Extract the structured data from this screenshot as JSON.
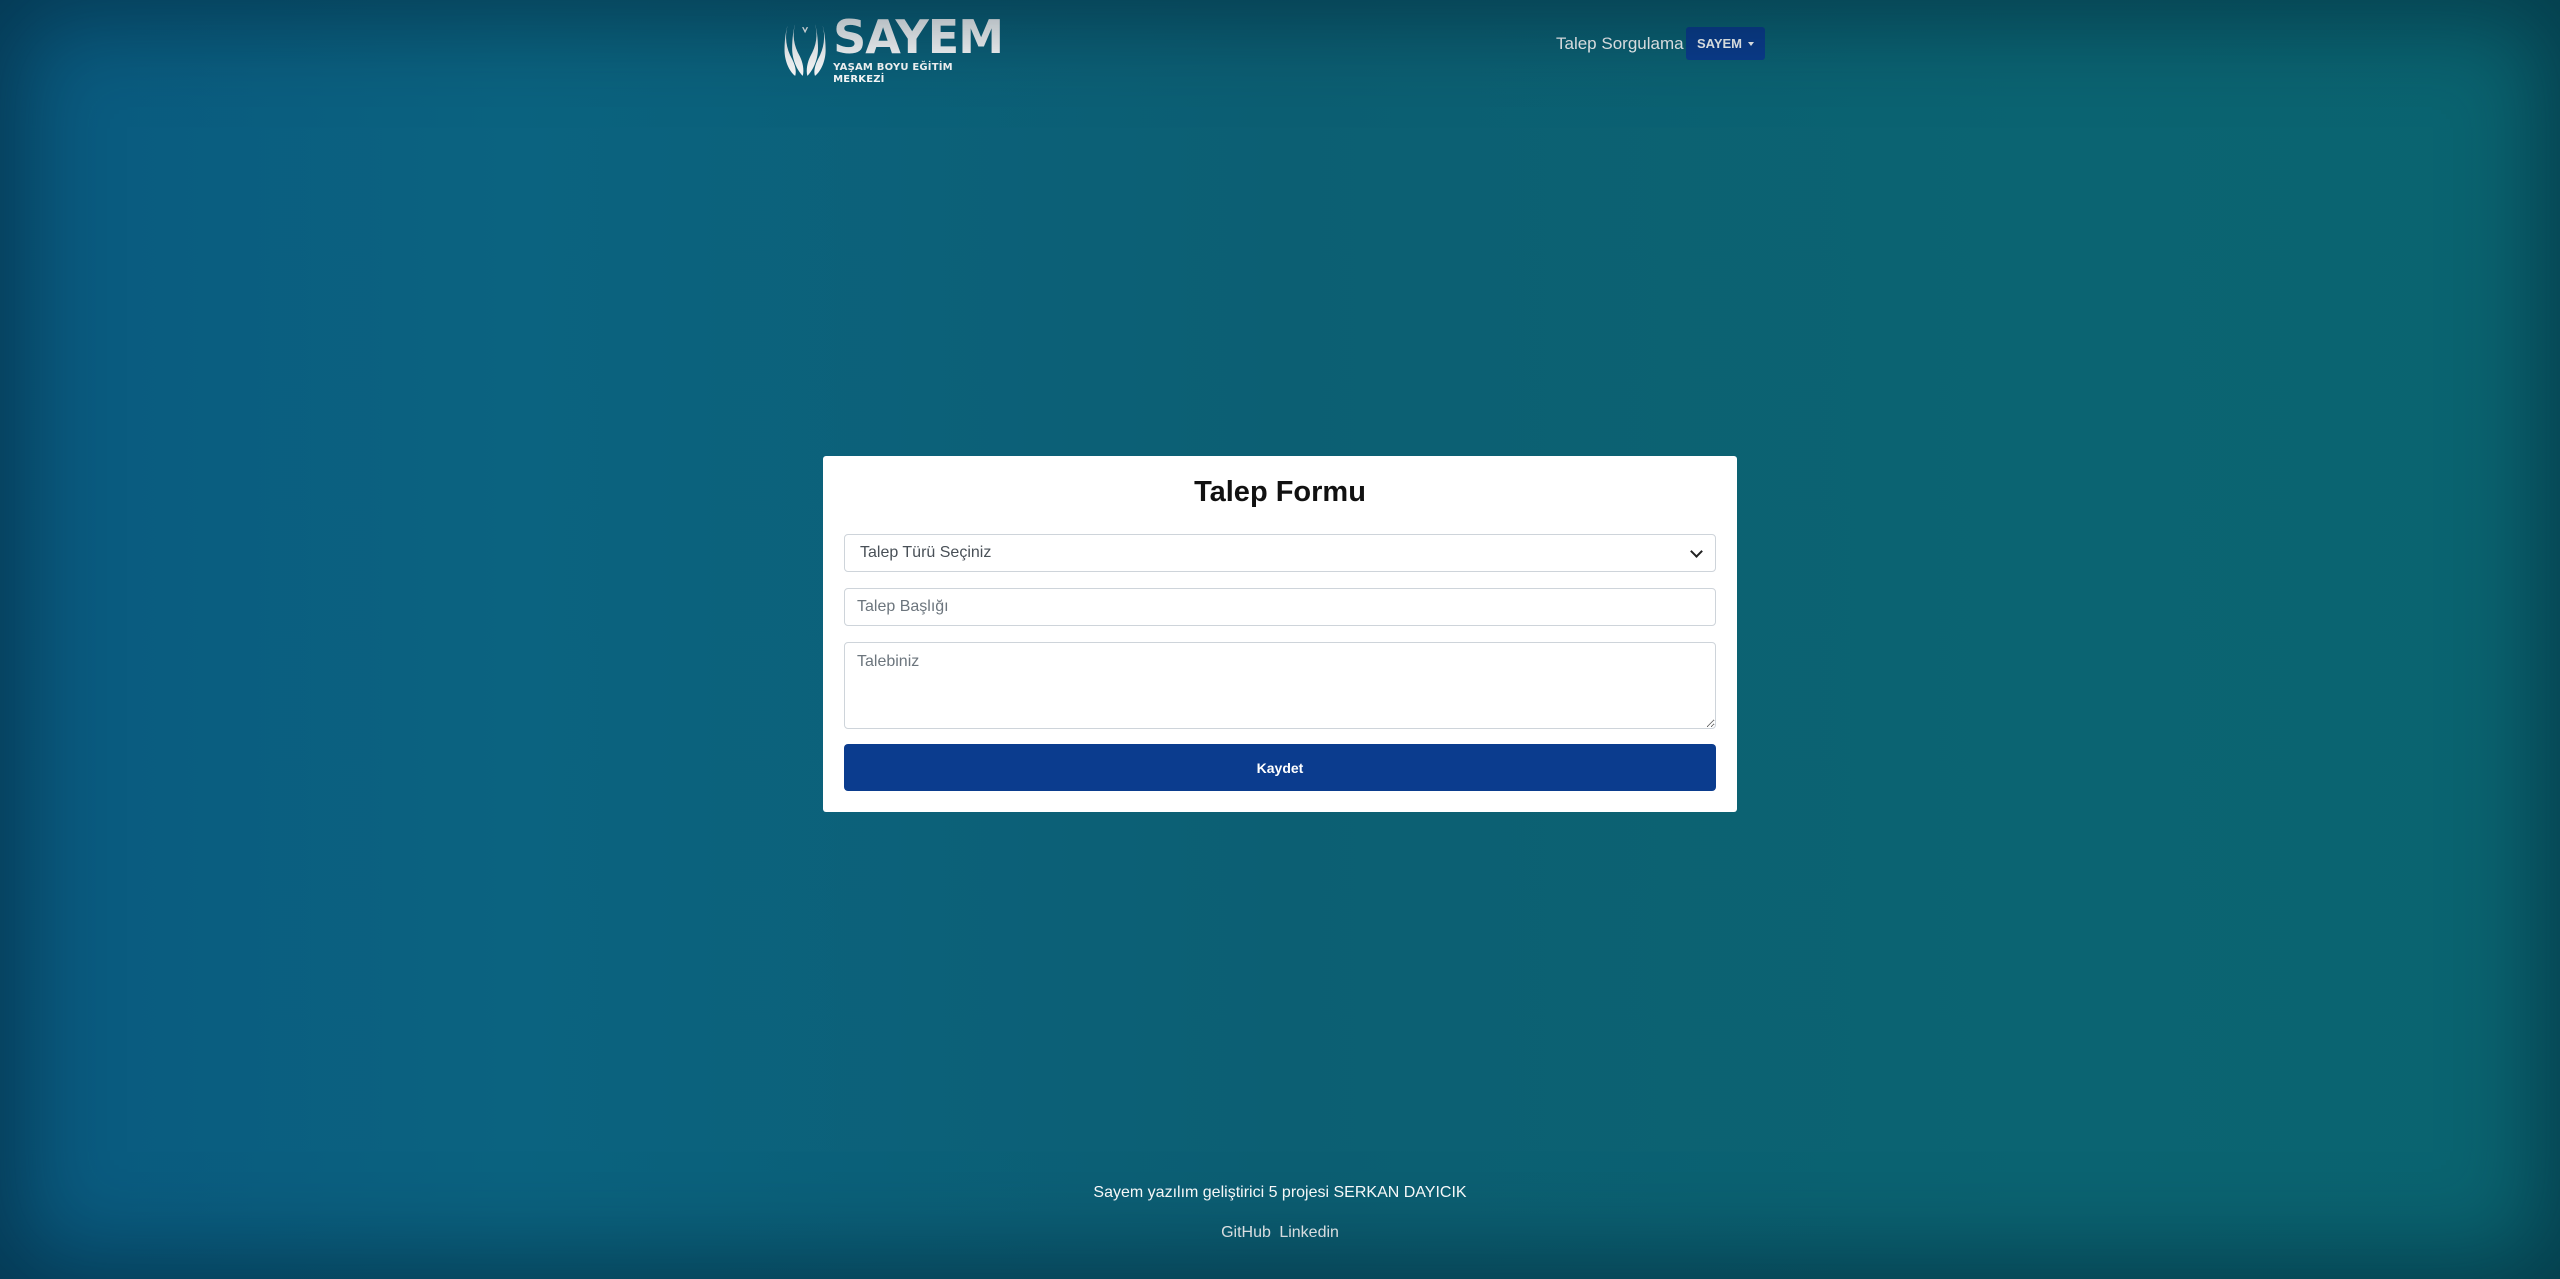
{
  "header": {
    "logo": {
      "name": "SAYEM",
      "tagline": "YAŞAM BOYU EĞİTİM MERKEZİ"
    },
    "nav_link": "Talep Sorgulama",
    "dropdown_label": "SAYEM"
  },
  "form": {
    "title": "Talep Formu",
    "type_select": "Talep Türü Seçiniz",
    "title_placeholder": "Talep Başlığı",
    "body_placeholder": "Talebiniz",
    "submit_label": "Kaydet"
  },
  "footer": {
    "text": "Sayem yazılım geliştirici 5 projesi SERKAN DAYICIK",
    "links": [
      "GitHub",
      "Linkedin"
    ]
  },
  "colors": {
    "primary_button": "#0b3c8e",
    "background": "#0c5f73"
  }
}
